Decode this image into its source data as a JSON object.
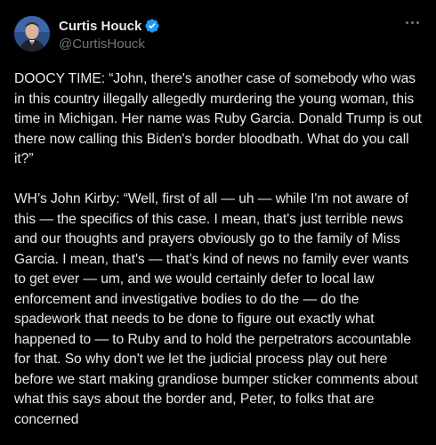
{
  "author": {
    "display_name": "Curtis Houck",
    "handle": "@CurtisHouck",
    "verified": true,
    "verified_color": "#1d9bf0"
  },
  "menu": {
    "icon": "more-horizontal-icon"
  },
  "tweet": {
    "paragraphs": [
      "DOOCY TIME: “John, there's another case of somebody who was in this country illegally allegedly murdering the young woman, this time in Michigan. Her name was Ruby Garcia. Donald Trump is out there now calling this Biden's border bloodbath. What do you call it?”",
      "WH’s John Kirby: “Well, first of all — uh — while I'm not aware of this — the specifics of this case. I mean, that's just terrible news and our thoughts and prayers obviously go to the family of Miss Garcia. I mean, that's — that’s kind of news no family ever wants to get ever — um, and we would certainly defer to local law enforcement and investigative bodies to do the — do the spadework that needs to be done to figure out exactly what happened to — to Ruby and to hold the perpetrators accountable for that. So why don't we let the judicial process play out here before we start making grandiose bumper sticker comments about what this says about the border and, Peter, to folks that are concerned"
    ]
  },
  "colors": {
    "background": "#000000",
    "text": "#e7e9ea",
    "secondary_text": "#71767b",
    "accent": "#1d9bf0"
  }
}
